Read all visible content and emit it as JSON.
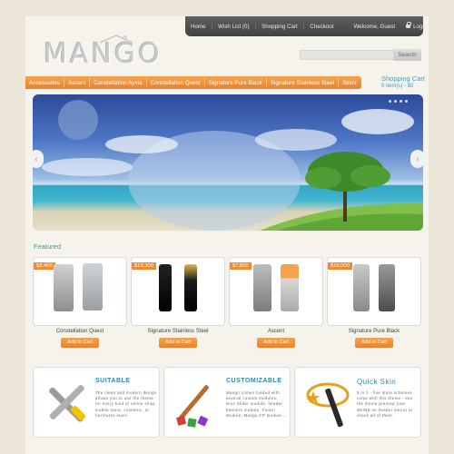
{
  "topnav": {
    "home": "Home",
    "wishlist": "Wish List (0)",
    "cart": "Shopping Cart",
    "checkout": "Checkout",
    "welcome": "Welcome, Guest",
    "login": "Login"
  },
  "logo": {
    "text": "MANGO"
  },
  "search": {
    "placeholder": "",
    "button": "Search"
  },
  "menu": {
    "items": [
      "Accessories",
      "Ascent",
      "Constellation Ayxta",
      "Constellation Quest",
      "Signature Pure Black",
      "Signature Stainless Steel",
      "Skins"
    ]
  },
  "cart": {
    "title": "Shopping Cart",
    "items": "0 item(s) - $0"
  },
  "featured": {
    "title": "Featured",
    "products": [
      {
        "price": "$8,400",
        "name": "Constellation Quest",
        "button": "Add to Cart"
      },
      {
        "price": "$13,300",
        "name": "Signature Stainless Steel",
        "button": "Add to Cart"
      },
      {
        "price": "$7,800",
        "name": "Ascent",
        "button": "Add to Cart"
      },
      {
        "price": "$16,000",
        "name": "Signature Pure Black",
        "button": "Add to Cart"
      }
    ]
  },
  "features": [
    {
      "title": "SUITABLE",
      "text": "The clean and modern design allows you to use the theme for every kind of online shop, mobile store, cosmetic, or furnitures store."
    },
    {
      "title": "CUSTOMIZABLE",
      "text": "Mango comes loaded with several custom modules: Nivo Slider module, header banners module, Footer Module, Mango CP module..."
    },
    {
      "title": "Quick Skin",
      "text": "5 in 1 - five more schemes come with this theme - see the theme preview (use SKINS on header menu) to check all of them."
    }
  ],
  "colors": {
    "accent": "#e9822b",
    "link": "#4a98b8",
    "dark_nav": "#4a4a4a"
  }
}
